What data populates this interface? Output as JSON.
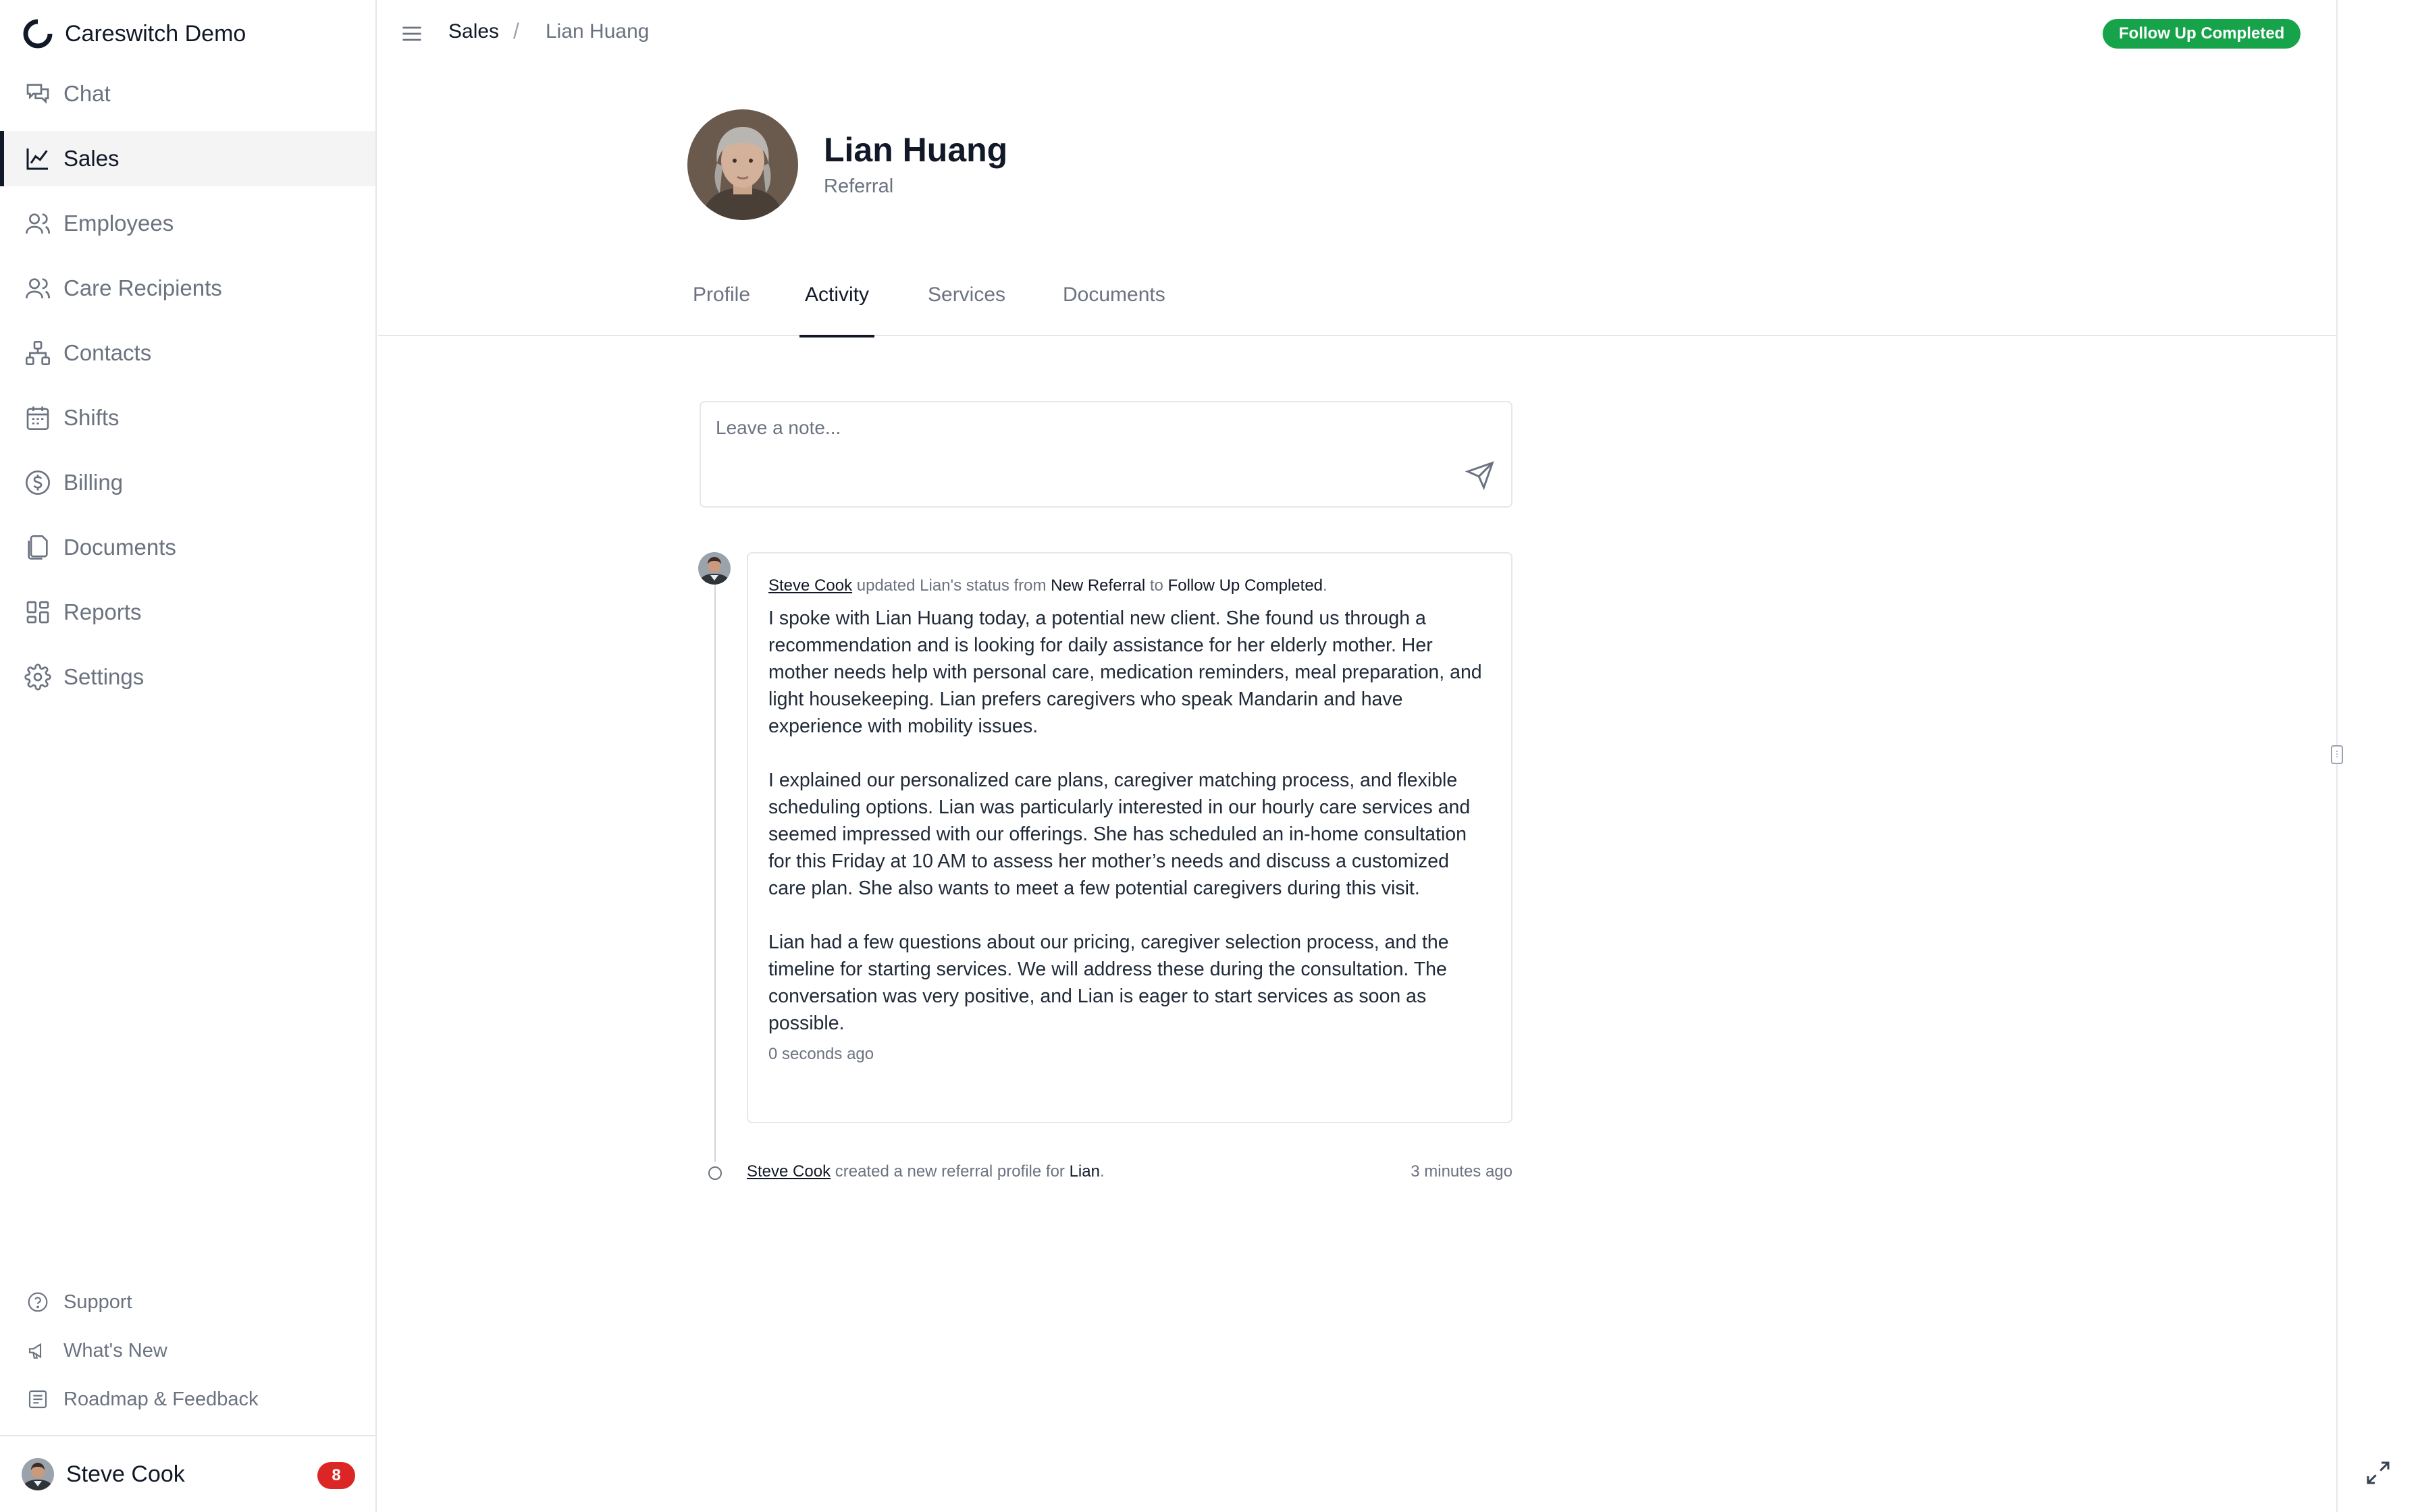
{
  "app": {
    "name": "Careswitch Demo"
  },
  "sidebar": {
    "items": [
      {
        "label": "Chat",
        "icon": "chat-icon",
        "active": false
      },
      {
        "label": "Sales",
        "icon": "chart-line-icon",
        "active": true
      },
      {
        "label": "Employees",
        "icon": "users-icon",
        "active": false
      },
      {
        "label": "Care Recipients",
        "icon": "users-icon",
        "active": false
      },
      {
        "label": "Contacts",
        "icon": "network-icon",
        "active": false
      },
      {
        "label": "Shifts",
        "icon": "calendar-icon",
        "active": false
      },
      {
        "label": "Billing",
        "icon": "dollar-circle-icon",
        "active": false
      },
      {
        "label": "Documents",
        "icon": "files-icon",
        "active": false
      },
      {
        "label": "Reports",
        "icon": "grid-icon",
        "active": false
      },
      {
        "label": "Settings",
        "icon": "gear-icon",
        "active": false
      }
    ],
    "bottom_links": [
      {
        "label": "Support",
        "icon": "help-circle-icon"
      },
      {
        "label": "What's New",
        "icon": "megaphone-icon"
      },
      {
        "label": "Roadmap & Feedback",
        "icon": "list-icon"
      }
    ],
    "user": {
      "name": "Steve Cook",
      "notifications": "8"
    }
  },
  "breadcrumb": {
    "section": "Sales",
    "separator": "/",
    "current": "Lian Huang"
  },
  "status_badge": {
    "label": "Follow Up Completed",
    "color": "#16a34a"
  },
  "profile": {
    "name": "Lian Huang",
    "subtitle": "Referral"
  },
  "tabs": [
    {
      "label": "Profile",
      "active": false
    },
    {
      "label": "Activity",
      "active": true
    },
    {
      "label": "Services",
      "active": false
    },
    {
      "label": "Documents",
      "active": false
    }
  ],
  "note": {
    "placeholder": "Leave a note..."
  },
  "activity": [
    {
      "actor": "Steve Cook",
      "text_1": " updated Lian's status from ",
      "from_status": "New Referral",
      "text_2": " to ",
      "to_status": "Follow Up Completed",
      "text_3": ".",
      "paragraphs": [
        "I spoke with Lian Huang today, a potential new client. She found us through a recommendation and is looking for daily assistance for her elderly mother. Her mother needs help with personal care, medication reminders, meal preparation, and light housekeeping. Lian prefers caregivers who speak Mandarin and have experience with mobility issues.",
        "I explained our personalized care plans, caregiver matching process, and flexible scheduling options. Lian was particularly interested in our hourly care services and seemed impressed with our offerings. She has scheduled an in-home consultation for this Friday at 10 AM to assess her mother’s needs and discuss a customized care plan. She also wants to meet a few potential caregivers during this visit.",
        "Lian had a few questions about our pricing, caregiver selection process, and the timeline for starting services. We will address these during the consultation. The conversation was very positive, and Lian is eager to start services as soon as possible."
      ],
      "time": "0 seconds ago"
    },
    {
      "actor": "Steve Cook",
      "text_1": " created a new referral profile for ",
      "target": "Lian",
      "text_2": ".",
      "time": "3 minutes ago"
    }
  ]
}
